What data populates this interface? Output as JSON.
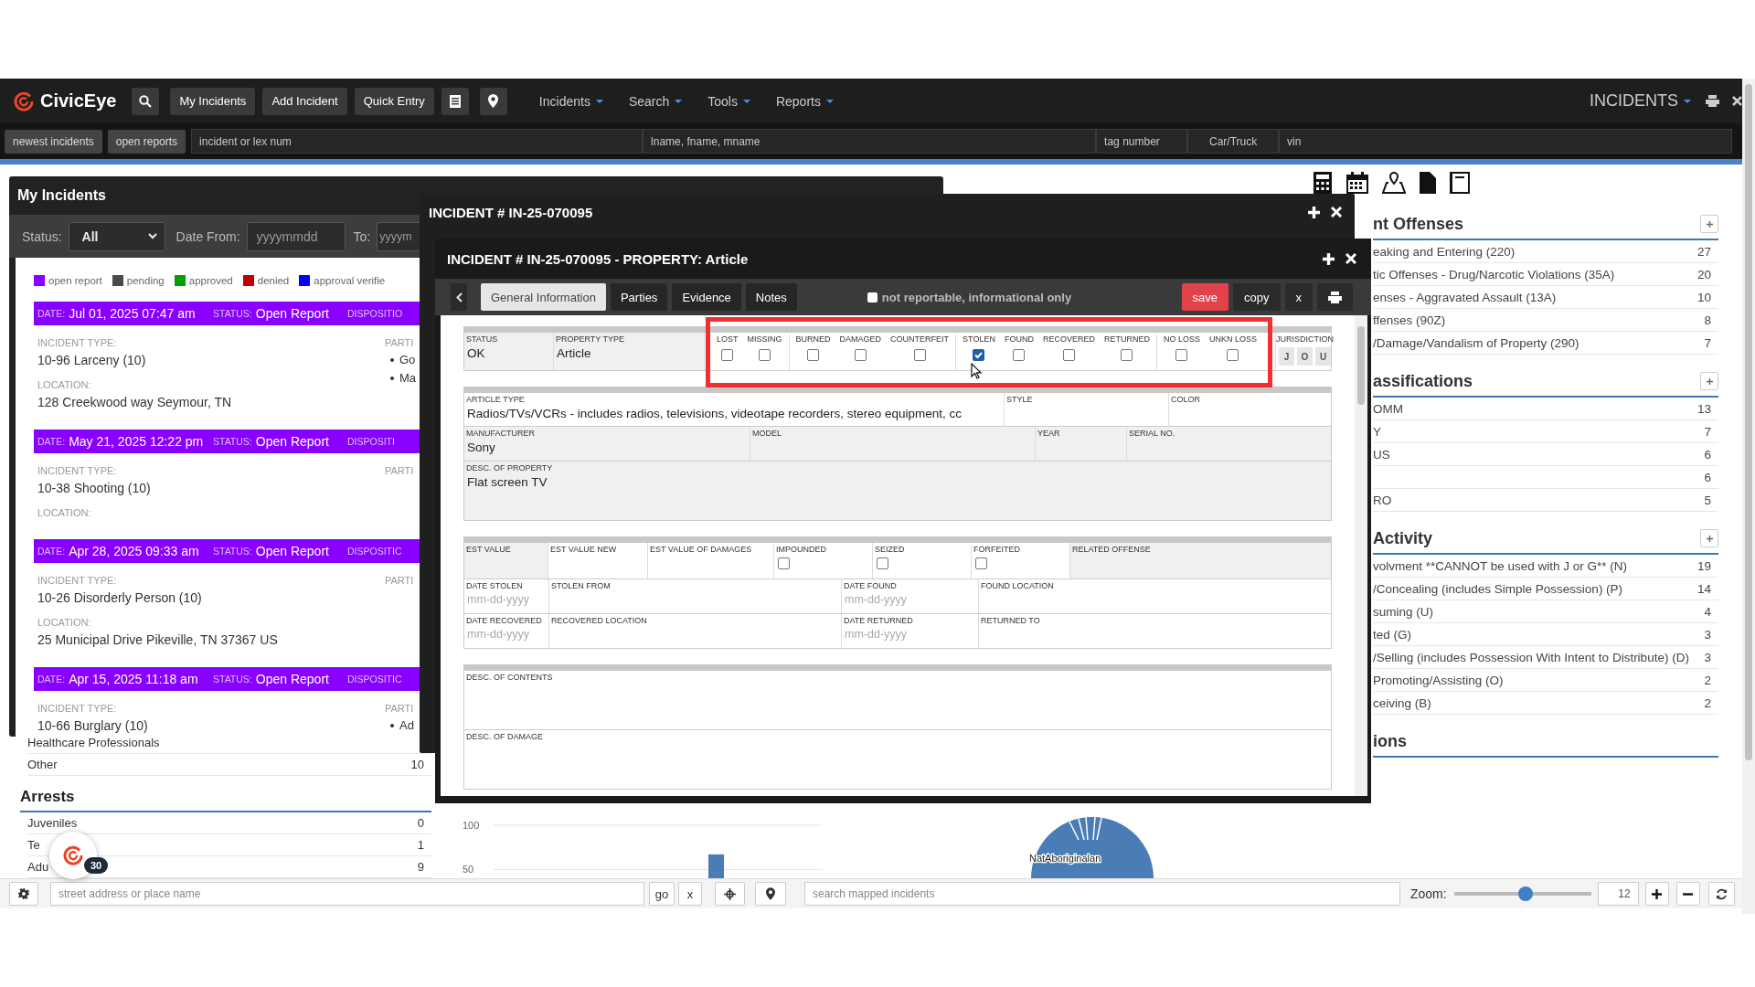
{
  "nav": {
    "logo": "CivicEye",
    "buttons": [
      "My Incidents",
      "Add Incident",
      "Quick Entry"
    ],
    "menus": [
      "Incidents",
      "Search",
      "Tools",
      "Reports"
    ],
    "module": "INCIDENTS"
  },
  "quick_search": {
    "buttons": [
      "newest incidents",
      "open reports"
    ],
    "fields": [
      {
        "placeholder": "incident or lex num"
      },
      {
        "placeholder": "lname, fname, mname"
      },
      {
        "placeholder": "tag number"
      },
      {
        "placeholder": "Car/Truck"
      },
      {
        "placeholder": "vin"
      }
    ]
  },
  "dashboard": {
    "left_rows": [
      {
        "label": "Healthcare Professionals"
      },
      {
        "label": "Other",
        "count": "10"
      }
    ],
    "arrests": {
      "title": "Arrests",
      "rows": [
        {
          "label": "Juveniles",
          "count": "0"
        },
        {
          "label": "Te",
          "count": "1"
        },
        {
          "label": "Adu",
          "count": "9"
        }
      ]
    },
    "chart_data": {
      "type": "bar",
      "values": [
        67
      ],
      "yticks": [
        50,
        100
      ],
      "ylim": [
        40,
        100
      ]
    },
    "pie_label": "NatAboriginalan",
    "sections": [
      {
        "title": "nt Offenses",
        "rows": [
          {
            "label": "eaking and Entering (220)",
            "count": "27"
          },
          {
            "label": "tic Offenses - Drug/Narcotic Violations (35A)",
            "count": "20"
          },
          {
            "label": "enses - Aggravated Assault (13A)",
            "count": "10"
          },
          {
            "label": "ffenses (90Z)",
            "count": "8"
          },
          {
            "label": "/Damage/Vandalism of Property (290)",
            "count": "7"
          }
        ]
      },
      {
        "title": "assifications",
        "rows": [
          {
            "label": "OMM",
            "count": "13"
          },
          {
            "label": "Y",
            "count": "7"
          },
          {
            "label": "US",
            "count": "6"
          },
          {
            "count": "6"
          },
          {
            "label": "RO",
            "count": "5"
          }
        ]
      },
      {
        "title": "Activity",
        "rows": [
          {
            "label": "volvment **CANNOT be used with J or G** (N)",
            "count": "19"
          },
          {
            "label": "/Concealing (includes Simple Possession) (P)",
            "count": "14"
          },
          {
            "label": "suming (U)",
            "count": "4"
          },
          {
            "label": "ted (G)",
            "count": "3"
          },
          {
            "label": "/Selling (includes Possession With Intent to Distribute) (D)",
            "count": "3"
          },
          {
            "label": "Promoting/Assisting (O)",
            "count": "2"
          },
          {
            "label": "ceiving (B)",
            "count": "2"
          }
        ]
      },
      {
        "title": "ions"
      }
    ]
  },
  "assistant": {
    "count": "30"
  },
  "my_incidents": {
    "title": "My Incidents",
    "status_label": "Status:",
    "status_value": "All",
    "date_from_label": "Date From:",
    "date_from_placeholder": "yyyymmdd",
    "to_label": "To:",
    "to_placeholder": "yyyym",
    "legend": [
      {
        "label": "open report",
        "color": "#8a00ff"
      },
      {
        "label": "pending",
        "color": "#4a4a4a"
      },
      {
        "label": "approved",
        "color": "#00a000"
      },
      {
        "label": "denied",
        "color": "#c00000"
      },
      {
        "label": "approval verifie",
        "color": "#0000ff"
      }
    ],
    "incidents": [
      {
        "color": "#8a00ff",
        "date_label": "DATE:",
        "date": "Jul 01, 2025 07:47 am",
        "status_label": "STATUS:",
        "status": "Open Report",
        "disposition_label": "DISPOSITIO",
        "type_label": "INCIDENT TYPE:",
        "type": "10-96 Larceny (10)",
        "location_label": "LOCATION:",
        "location": "128 Creekwood way Seymour, TN",
        "parties_label": "PARTI",
        "parties": [
          "Go",
          "Ma"
        ]
      },
      {
        "color": "#8a00ff",
        "date_label": "DATE:",
        "date": "May 21, 2025 12:22 pm",
        "status_label": "STATUS:",
        "status": "Open Report",
        "disposition_label": "DISPOSITI",
        "type_label": "INCIDENT TYPE:",
        "type": "10-38 Shooting (10)",
        "location_label": "LOCATION:",
        "parties_label": "PARTI"
      },
      {
        "color": "#8a00ff",
        "date_label": "DATE:",
        "date": "Apr 28, 2025 09:33 am",
        "status_label": "STATUS:",
        "status": "Open Report",
        "disposition_label": "DISPOSITIC",
        "type_label": "INCIDENT TYPE:",
        "type": "10-26 Disorderly Person (10)",
        "location_label": "LOCATION:",
        "location": "25 Municipal Drive Pikeville, TN 37367 US",
        "parties_label": "PARTI"
      },
      {
        "color": "#8a00ff",
        "date_label": "DATE:",
        "date": "Apr 15, 2025 11:18 am",
        "status_label": "STATUS:",
        "status": "Open Report",
        "disposition_label": "DISPOSITIC",
        "type_label": "INCIDENT TYPE:",
        "type": "10-66 Burglary (10)",
        "parties_label": "PARTI",
        "parties": [
          "Ad"
        ]
      }
    ]
  },
  "incident_window": {
    "title": "INCIDENT # IN-25-070095"
  },
  "property_window": {
    "title": "INCIDENT # IN-25-070095 - PROPERTY: Article",
    "tabs": [
      {
        "label": "General Information",
        "selected": true
      },
      {
        "label": "Parties",
        "selected": false
      },
      {
        "label": "Evidence",
        "selected": false
      },
      {
        "label": "Notes",
        "selected": false
      }
    ],
    "not_reportable": {
      "label": "not reportable, informational only",
      "checked": false
    },
    "actions": [
      {
        "label": "save",
        "kind": "primary"
      },
      {
        "label": "copy",
        "kind": "plain"
      },
      {
        "label": "x",
        "kind": "plain"
      }
    ],
    "status": {
      "label": "STATUS",
      "value": "OK",
      "readonly": true
    },
    "property_type": {
      "label": "PROPERTY TYPE",
      "value": "Article",
      "readonly": true
    },
    "loss_groups": [
      {
        "options": [
          {
            "label": "LOST",
            "checked": false
          },
          {
            "label": "MISSING",
            "checked": false
          }
        ]
      },
      {
        "options": [
          {
            "label": "BURNED",
            "checked": false
          },
          {
            "label": "DAMAGED",
            "checked": false
          },
          {
            "label": "COUNTERFEIT",
            "checked": false
          }
        ]
      },
      {
        "options": [
          {
            "label": "STOLEN",
            "checked": true
          },
          {
            "label": "FOUND",
            "checked": false
          },
          {
            "label": "RECOVERED",
            "checked": false
          },
          {
            "label": "RETURNED",
            "checked": false
          }
        ]
      },
      {
        "options": [
          {
            "label": "NO LOSS",
            "checked": false
          },
          {
            "label": "UNKN LOSS",
            "checked": false
          }
        ]
      }
    ],
    "jurisdiction": {
      "label": "JURISDICTION",
      "options": [
        "J",
        "O",
        "U"
      ]
    },
    "sections": [
      {
        "rows": [
          {
            "cells": [
              {
                "kind": "text",
                "label": "ARTICLE TYPE",
                "value": "Radios/TVs/VCRs - includes radios, televisions, videotape recorders, stereo equipment, cc",
                "readonly": false
              },
              {
                "kind": "text",
                "label": "STYLE",
                "readonly": false
              },
              {
                "kind": "text",
                "label": "COLOR",
                "readonly": false
              }
            ]
          },
          {
            "cells": [
              {
                "kind": "text",
                "label": "MANUFACTURER",
                "value": "Sony",
                "readonly": true
              },
              {
                "kind": "text",
                "label": "MODEL",
                "readonly": true
              },
              {
                "kind": "text",
                "label": "YEAR",
                "readonly": true
              },
              {
                "kind": "text",
                "label": "SERIAL NO.",
                "readonly": true
              }
            ]
          },
          {
            "cells": [
              {
                "kind": "text",
                "label": "DESC. OF PROPERTY",
                "value": "Flat screen TV",
                "readonly": true
              }
            ]
          }
        ]
      },
      {
        "rows": [
          {
            "cells": [
              {
                "kind": "text",
                "label": "EST VALUE",
                "readonly": true
              },
              {
                "kind": "text",
                "label": "EST VALUE NEW",
                "readonly": false
              },
              {
                "kind": "text",
                "label": "EST VALUE OF DAMAGES",
                "readonly": false
              },
              {
                "kind": "checkbox",
                "label": "IMPOUNDED",
                "checked": false,
                "readonly": false
              },
              {
                "kind": "checkbox",
                "label": "SEIZED",
                "checked": false,
                "readonly": false
              },
              {
                "kind": "checkbox",
                "label": "FORFEITED",
                "checked": false,
                "readonly": false
              },
              {
                "kind": "text",
                "label": "RELATED OFFENSE",
                "readonly": true
              }
            ]
          },
          {
            "cells": [
              {
                "kind": "date",
                "label": "DATE STOLEN",
                "placeholder": "mm-dd-yyyy",
                "readonly": false
              },
              {
                "kind": "text",
                "label": "STOLEN FROM",
                "readonly": false
              },
              {
                "kind": "date",
                "label": "DATE FOUND",
                "placeholder": "mm-dd-yyyy",
                "readonly": false
              },
              {
                "kind": "text",
                "label": "FOUND LOCATION",
                "readonly": false
              }
            ]
          },
          {
            "cells": [
              {
                "kind": "date",
                "label": "DATE RECOVERED",
                "placeholder": "mm-dd-yyyy",
                "readonly": false
              },
              {
                "kind": "text",
                "label": "RECOVERED LOCATION",
                "readonly": false
              },
              {
                "kind": "date",
                "label": "DATE RETURNED",
                "placeholder": "mm-dd-yyyy",
                "readonly": false
              },
              {
                "kind": "text",
                "label": "RETURNED TO",
                "readonly": false
              }
            ]
          }
        ]
      },
      {
        "rows": [
          {
            "cells": [
              {
                "kind": "text",
                "label": "DESC. OF CONTENTS",
                "readonly": false
              }
            ]
          },
          {
            "cells": [
              {
                "kind": "text",
                "label": "DESC. OF DAMAGE",
                "readonly": false
              }
            ]
          }
        ]
      }
    ]
  },
  "bottom_bar": {
    "address_placeholder": "street address or place name",
    "go": "go",
    "clear": "x",
    "search_placeholder": "search mapped incidents",
    "zoom_label": "Zoom:",
    "zoom": {
      "level": 0.52
    },
    "zoom_value": "12"
  }
}
